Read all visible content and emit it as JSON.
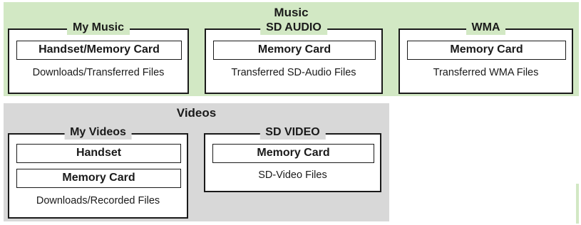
{
  "music": {
    "title": "Music",
    "boxes": [
      {
        "title": "My Music",
        "storage": "Handset/Memory Card",
        "desc": "Downloads/Transferred Files"
      },
      {
        "title": "SD AUDIO",
        "storage": "Memory Card",
        "desc": "Transferred SD-Audio Files"
      },
      {
        "title": "WMA",
        "storage": "Memory Card",
        "desc": "Transferred WMA Files"
      }
    ]
  },
  "videos": {
    "title": "Videos",
    "boxes": [
      {
        "title": "My Videos",
        "storage": [
          "Handset",
          "Memory Card"
        ],
        "desc": "Downloads/Recorded Files"
      },
      {
        "title": "SD VIDEO",
        "storage": "Memory Card",
        "desc": "SD-Video Files"
      }
    ]
  }
}
